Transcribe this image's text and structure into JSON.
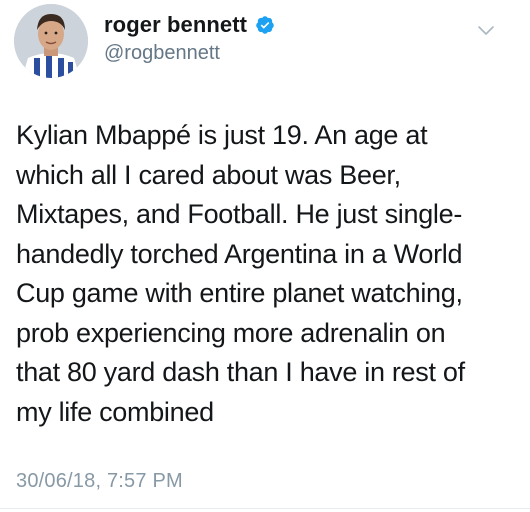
{
  "author": {
    "display_name": "roger bennett",
    "handle": "@rogbennett",
    "verified": true,
    "avatar_icon": "profile-photo"
  },
  "tweet": {
    "lines": [
      "Kylian Mbappé is just 19. An age at",
      "which all I cared about was Beer,",
      "Mixtapes, and Football. He just single-",
      "handedly torched Argentina in a World",
      "Cup game with entire planet watching,",
      "prob experiencing more adrenalin on",
      "that 80 yard dash than I have in rest of",
      "my life combined"
    ],
    "timestamp": "30/06/18, 7:57 PM"
  },
  "colors": {
    "text": "#14171a",
    "secondary": "#657786",
    "timestamp": "#8899a6",
    "verified_badge": "#1da1f2"
  },
  "icons": {
    "verified": "verified-badge-icon",
    "more": "chevron-down-icon"
  }
}
